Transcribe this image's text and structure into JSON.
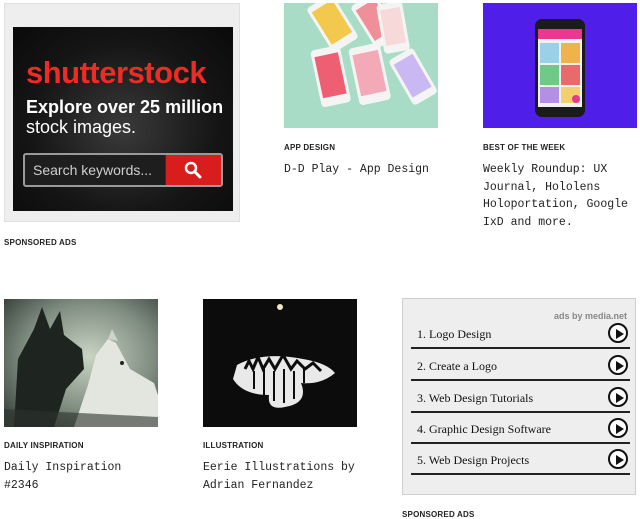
{
  "ad_top": {
    "logo_left": "shutterst",
    "logo_o": "o",
    "logo_right": "ck",
    "headline_1": "Explore over 25 million",
    "headline_2": "stock images.",
    "search_placeholder": "Search keywords...",
    "sponsored_label": "SPONSORED ADS"
  },
  "cards": [
    {
      "category": "APP DESIGN",
      "title": "D-D Play - App Design"
    },
    {
      "category": "BEST OF THE WEEK",
      "title": "Weekly Roundup: UX Journal, Hololens Holoportation, Google IxD and more."
    },
    {
      "category": "DAILY INSPIRATION",
      "title": "Daily Inspiration #2346"
    },
    {
      "category": "ILLUSTRATION",
      "title": "Eerie Illustrations by Adrian Fernandez"
    }
  ],
  "ad_bottom": {
    "attribution": "ads by media.net",
    "items": [
      "1. Logo Design",
      "2. Create a Logo",
      "3. Web Design Tutorials",
      "4. Graphic Design Software",
      "5. Web Design Projects"
    ],
    "sponsored_label": "SPONSORED ADS"
  },
  "colors": {
    "shutterstock_red": "#ee2b24",
    "app_bg": "#a9dcc6",
    "purple_bg": "#4f1ee8"
  }
}
